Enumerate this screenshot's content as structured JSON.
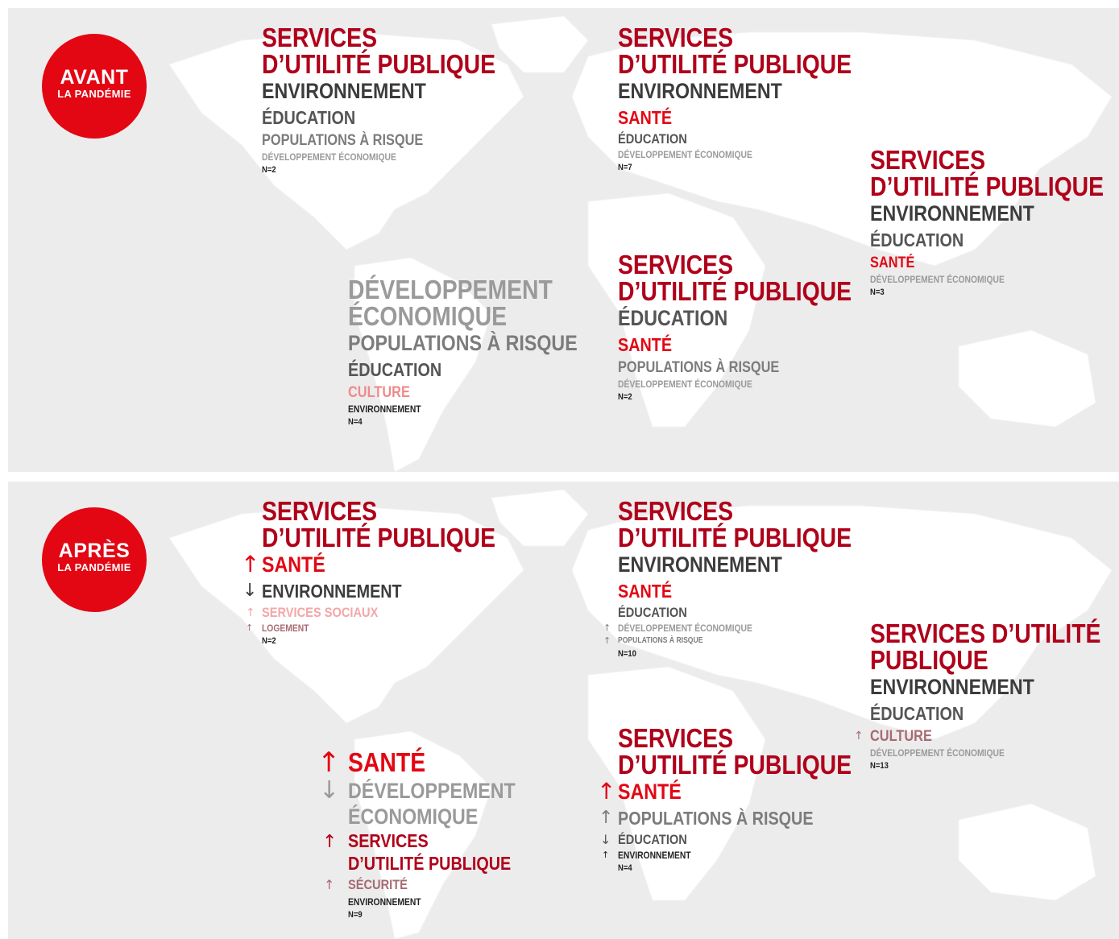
{
  "before": {
    "badge": {
      "title": "AVANT",
      "subtitle": "LA PANDÉMIE"
    },
    "north_america": {
      "items": [
        "SERVICES",
        "D’UTILITÉ PUBLIQUE",
        "ENVIRONNEMENT",
        "ÉDUCATION",
        "POPULATIONS À RISQUE",
        "DÉVELOPPEMENT ÉCONOMIQUE"
      ],
      "n": "N=2"
    },
    "europe": {
      "items": [
        "SERVICES",
        "D’UTILITÉ PUBLIQUE",
        "ENVIRONNEMENT",
        "SANTÉ",
        "ÉDUCATION",
        "DÉVELOPPEMENT ÉCONOMIQUE"
      ],
      "n": "N=7"
    },
    "asia": {
      "items": [
        "SERVICES",
        "D’UTILITÉ PUBLIQUE",
        "ENVIRONNEMENT",
        "ÉDUCATION",
        "SANTÉ",
        "DÉVELOPPEMENT ÉCONOMIQUE"
      ],
      "n": "N=3"
    },
    "south_america": {
      "items": [
        "DÉVELOPPEMENT",
        "ÉCONOMIQUE",
        "POPULATIONS À RISQUE",
        "ÉDUCATION",
        "CULTURE",
        "ENVIRONNEMENT"
      ],
      "n": "N=4"
    },
    "africa": {
      "items": [
        "SERVICES",
        "D’UTILITÉ PUBLIQUE",
        "ÉDUCATION",
        "SANTÉ",
        "POPULATIONS À RISQUE",
        "DÉVELOPPEMENT ÉCONOMIQUE"
      ],
      "n": "N=2"
    }
  },
  "after": {
    "badge": {
      "title": "APRÈS",
      "subtitle": "LA PANDÉMIE"
    },
    "north_america": {
      "items": [
        "SERVICES",
        "D’UTILITÉ PUBLIQUE",
        "SANTÉ",
        "ENVIRONNEMENT",
        "SERVICES SOCIAUX",
        "LOGEMENT"
      ],
      "arrows": [
        "",
        "",
        "↑",
        "↓",
        "↑",
        "↑"
      ],
      "n": "N=2"
    },
    "europe": {
      "items": [
        "SERVICES",
        "D’UTILITÉ PUBLIQUE",
        "ENVIRONNEMENT",
        "SANTÉ",
        "ÉDUCATION",
        "DÉVELOPPEMENT ÉCONOMIQUE",
        "POPULATIONS À RISQUE"
      ],
      "arrows": [
        "",
        "",
        "",
        "",
        "",
        "↑",
        "↑"
      ],
      "n": "N=10"
    },
    "asia": {
      "items": [
        "SERVICES D’UTILITÉ",
        "PUBLIQUE",
        "ENVIRONNEMENT",
        "ÉDUCATION",
        "CULTURE",
        "DÉVELOPPEMENT ÉCONOMIQUE"
      ],
      "arrows": [
        "",
        "",
        "",
        "",
        "↑",
        ""
      ],
      "n": "N=13"
    },
    "south_america": {
      "items": [
        "SANTÉ",
        "DÉVELOPPEMENT",
        "ÉCONOMIQUE",
        "SERVICES",
        "D’UTILITÉ PUBLIQUE",
        "SÉCURITÉ",
        "ENVIRONNEMENT"
      ],
      "arrows": [
        "↑",
        "↓",
        "",
        "↑",
        "",
        "↑",
        ""
      ],
      "n": "N=9"
    },
    "africa": {
      "items": [
        "SERVICES",
        "D’UTILITÉ PUBLIQUE",
        "SANTÉ",
        "POPULATIONS À RISQUE",
        "ÉDUCATION",
        "ENVIRONNEMENT"
      ],
      "arrows": [
        "",
        "",
        "↑",
        "↑",
        "↓",
        "↑"
      ],
      "n": "N=4"
    }
  }
}
